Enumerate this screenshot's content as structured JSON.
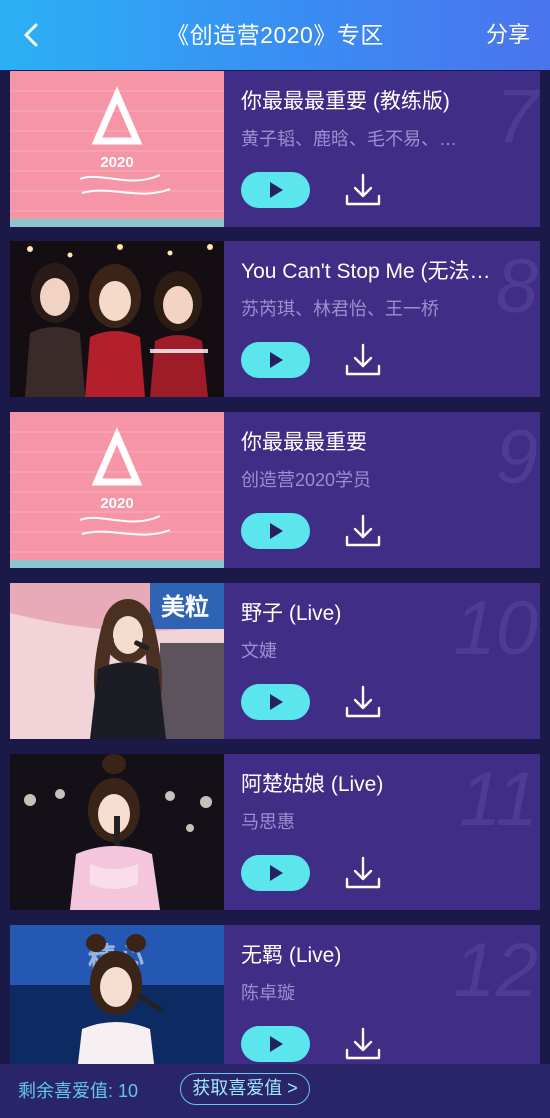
{
  "header": {
    "title": "《创造营2020》专区",
    "share_label": "分享"
  },
  "songs": [
    {
      "title": "你最最最重要 (教练版)",
      "artist": "黄子韬、鹿晗、毛不易、…",
      "rank": "7",
      "thumb": "logo"
    },
    {
      "title": "You Can't Stop Me (无法…",
      "artist": "苏芮琪、林君怡、王一桥",
      "rank": "8",
      "thumb": "group"
    },
    {
      "title": "你最最最重要",
      "artist": "创造营2020学员",
      "rank": "9",
      "thumb": "logo"
    },
    {
      "title": "野子 (Live)",
      "artist": "文婕",
      "rank": "10",
      "thumb": "singer-wall"
    },
    {
      "title": "阿楚姑娘 (Live)",
      "artist": "马思惠",
      "rank": "11",
      "thumb": "singer-stage"
    },
    {
      "title": "无羁 (Live)",
      "artist": "陈卓璇",
      "rank": "12",
      "thumb": "singer-blue"
    }
  ],
  "logo_text": "2020",
  "footer": {
    "label": "剩余喜爱值: 10",
    "button_label": "获取喜爱值 >"
  },
  "colors": {
    "card_bg": "#402d85",
    "play_button": "#5be6ee",
    "accent_text": "#62c8ee"
  }
}
